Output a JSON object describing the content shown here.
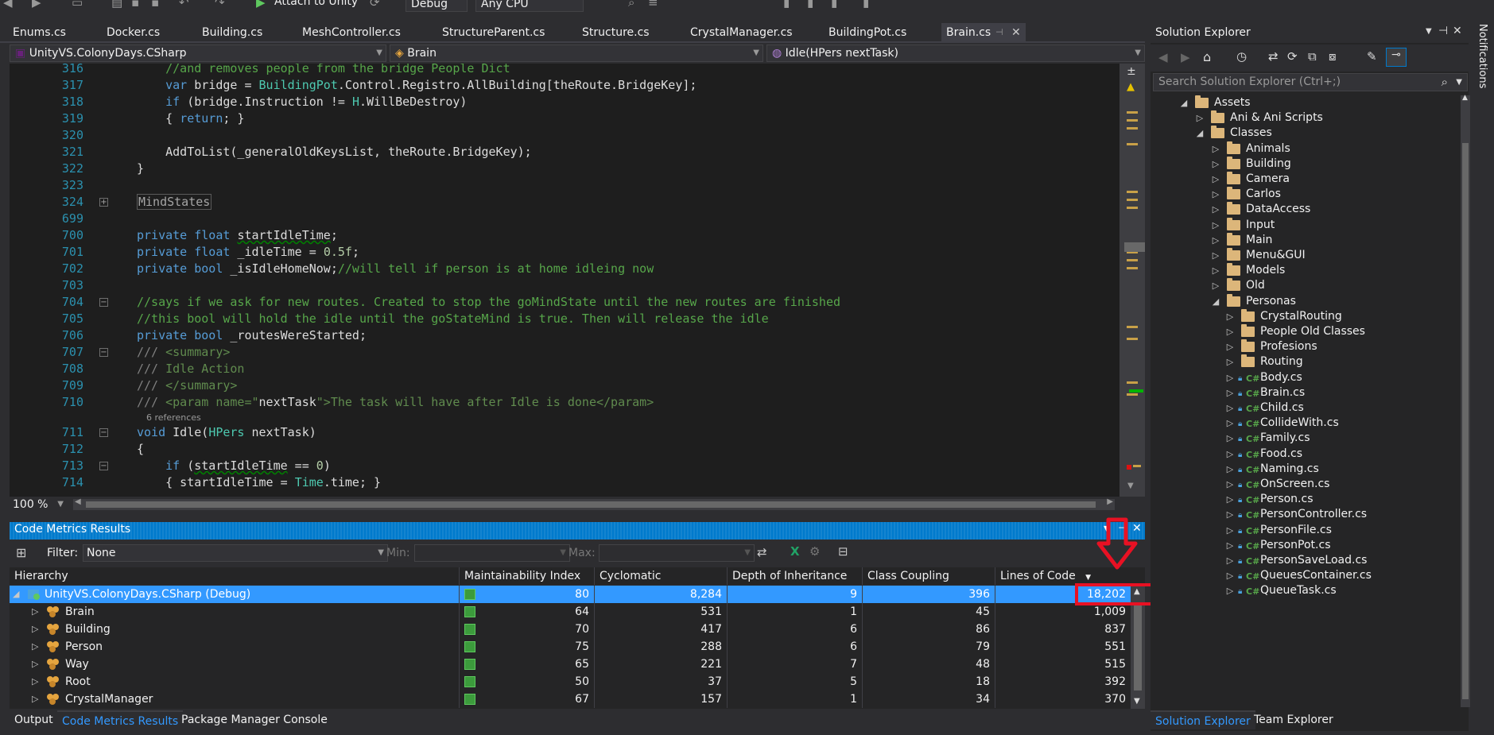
{
  "toolbar": {
    "attach_label": "Attach to Unity",
    "config": "Debug",
    "platform": "Any CPU"
  },
  "doc_tabs": [
    "Enums.cs",
    "Docker.cs",
    "Building.cs",
    "MeshController.cs",
    "StructureParent.cs",
    "Structure.cs",
    "CrystalManager.cs",
    "BuildingPot.cs",
    "Brain.cs"
  ],
  "nav": {
    "project": "UnityVS.ColonyDays.CSharp",
    "class": "Brain",
    "member": "Idle(HPers nextTask)"
  },
  "code": [
    {
      "ln": "316",
      "segs": [
        [
          "cm",
          "    //and removes people from the bridge People Dict"
        ]
      ]
    },
    {
      "ln": "317",
      "segs": [
        [
          "kw",
          "    var"
        ],
        [
          "",
          " bridge = "
        ],
        [
          "ty",
          "BuildingPot"
        ],
        [
          "",
          ".Control.Registro.AllBuilding[theRoute.BridgeKey];"
        ]
      ]
    },
    {
      "ln": "318",
      "segs": [
        [
          "kw",
          "    if"
        ],
        [
          "",
          " (bridge.Instruction != "
        ],
        [
          "ty",
          "H"
        ],
        [
          "",
          ".WillBeDestroy)"
        ]
      ]
    },
    {
      "ln": "319",
      "segs": [
        [
          "",
          "    { "
        ],
        [
          "kw",
          "return"
        ],
        [
          "",
          "; }"
        ]
      ]
    },
    {
      "ln": "320",
      "segs": []
    },
    {
      "ln": "321",
      "segs": [
        [
          "",
          "    AddToList(_generalOldKeysList, theRoute.BridgeKey);"
        ]
      ]
    },
    {
      "ln": "322",
      "segs": [
        [
          "",
          "}"
        ]
      ]
    },
    {
      "ln": "323",
      "segs": []
    },
    {
      "ln": "324",
      "segs": [
        [
          "collapsed",
          "MindStates"
        ]
      ],
      "fold": "+"
    },
    {
      "ln": "699",
      "segs": []
    },
    {
      "ln": "700",
      "segs": [
        [
          "kw",
          "private float"
        ],
        [
          "",
          " "
        ],
        [
          "squig",
          "startIdleTime"
        ],
        [
          "",
          ";"
        ]
      ]
    },
    {
      "ln": "701",
      "segs": [
        [
          "kw",
          "private float"
        ],
        [
          "",
          " _idleTime = "
        ],
        [
          "num",
          "0.5f"
        ],
        [
          "",
          ";"
        ]
      ]
    },
    {
      "ln": "702",
      "segs": [
        [
          "kw",
          "private bool"
        ],
        [
          "",
          " _isIdleHomeNow;"
        ],
        [
          "cm",
          "//will tell if person is at home idleing now"
        ]
      ]
    },
    {
      "ln": "703",
      "segs": []
    },
    {
      "ln": "704",
      "segs": [
        [
          "cm",
          "//says if we ask for new routes. Created to stop the goMindState until the new routes are finished"
        ]
      ],
      "fold": "-"
    },
    {
      "ln": "705",
      "segs": [
        [
          "cm",
          "//this bool will hold the idle until the goStateMind is true. Then will release the idle"
        ]
      ]
    },
    {
      "ln": "706",
      "segs": [
        [
          "kw",
          "private bool"
        ],
        [
          "",
          " _routesWereStarted;"
        ]
      ]
    },
    {
      "ln": "707",
      "segs": [
        [
          "gray",
          "/// "
        ],
        [
          "xml",
          "<summary>"
        ]
      ],
      "fold": "-"
    },
    {
      "ln": "708",
      "segs": [
        [
          "gray",
          "/// "
        ],
        [
          "xml",
          "Idle Action"
        ]
      ]
    },
    {
      "ln": "709",
      "segs": [
        [
          "gray",
          "/// "
        ],
        [
          "xml",
          "</summary>"
        ]
      ]
    },
    {
      "ln": "710",
      "segs": [
        [
          "gray",
          "/// "
        ],
        [
          "xml",
          "<param name=\""
        ],
        [
          "",
          "nextTask"
        ],
        [
          "xml",
          "\">The task will have after Idle is done</param>"
        ]
      ]
    },
    {
      "ln": "711",
      "segs": [
        [
          "kw",
          "void"
        ],
        [
          "",
          " Idle("
        ],
        [
          "ty",
          "HPers"
        ],
        [
          "",
          " nextTask)"
        ]
      ],
      "fold": "-",
      "refs": "6 references"
    },
    {
      "ln": "712",
      "segs": [
        [
          "",
          "{"
        ]
      ]
    },
    {
      "ln": "713",
      "segs": [
        [
          "kw",
          "    if"
        ],
        [
          "",
          " ("
        ],
        [
          "squig",
          "startIdleTime"
        ],
        [
          "",
          " == "
        ],
        [
          "num",
          "0"
        ],
        [
          "",
          ")"
        ]
      ],
      "fold": "-"
    },
    {
      "ln": "714",
      "segs": [
        [
          "",
          "    { startIdleTime = "
        ],
        [
          "ty",
          "Time"
        ],
        [
          "",
          ".time; }"
        ]
      ]
    }
  ],
  "editor": {
    "zoom": "100 %"
  },
  "code_metrics": {
    "title": "Code Metrics Results",
    "filter_label": "Filter:",
    "filter_value": "None",
    "min_label": "Min:",
    "max_label": "Max:",
    "columns": [
      "Hierarchy",
      "Maintainability Index",
      "Cyclomatic Complexity",
      "Depth of Inheritance",
      "Class Coupling",
      "Lines of Code"
    ],
    "rows": [
      {
        "name": "UnityVS.ColonyDays.CSharp (Debug)",
        "mi": "80",
        "cc": "8,284",
        "di": "9",
        "coup": "396",
        "loc": "18,202",
        "root": true
      },
      {
        "name": "Brain",
        "mi": "64",
        "cc": "531",
        "di": "1",
        "coup": "45",
        "loc": "1,009"
      },
      {
        "name": "Building",
        "mi": "70",
        "cc": "417",
        "di": "6",
        "coup": "86",
        "loc": "837"
      },
      {
        "name": "Person",
        "mi": "75",
        "cc": "288",
        "di": "6",
        "coup": "79",
        "loc": "551"
      },
      {
        "name": "Way",
        "mi": "65",
        "cc": "221",
        "di": "7",
        "coup": "48",
        "loc": "515"
      },
      {
        "name": "Root",
        "mi": "50",
        "cc": "37",
        "di": "5",
        "coup": "18",
        "loc": "392"
      },
      {
        "name": "CrystalManager",
        "mi": "67",
        "cc": "157",
        "di": "1",
        "coup": "34",
        "loc": "370"
      }
    ]
  },
  "bottom_tabs": [
    "Output",
    "Code Metrics Results",
    "Package Manager Console"
  ],
  "solution_explorer": {
    "title": "Solution Explorer",
    "search_placeholder": "Search Solution Explorer (Ctrl+;)",
    "tree": [
      {
        "label": "Assets",
        "depth": 0,
        "kind": "folder",
        "open": true
      },
      {
        "label": "Ani & Ani Scripts",
        "depth": 1,
        "kind": "folder"
      },
      {
        "label": "Classes",
        "depth": 1,
        "kind": "folder",
        "open": true
      },
      {
        "label": "Animals",
        "depth": 2,
        "kind": "folder"
      },
      {
        "label": "Building",
        "depth": 2,
        "kind": "folder"
      },
      {
        "label": "Camera",
        "depth": 2,
        "kind": "folder"
      },
      {
        "label": "Carlos",
        "depth": 2,
        "kind": "folder"
      },
      {
        "label": "DataAccess",
        "depth": 2,
        "kind": "folder"
      },
      {
        "label": "Input",
        "depth": 2,
        "kind": "folder"
      },
      {
        "label": "Main",
        "depth": 2,
        "kind": "folder"
      },
      {
        "label": "Menu&GUI",
        "depth": 2,
        "kind": "folder"
      },
      {
        "label": "Models",
        "depth": 2,
        "kind": "folder"
      },
      {
        "label": "Old",
        "depth": 2,
        "kind": "folder"
      },
      {
        "label": "Personas",
        "depth": 2,
        "kind": "folder",
        "open": true
      },
      {
        "label": "CrystalRouting",
        "depth": 3,
        "kind": "folder"
      },
      {
        "label": "People Old Classes",
        "depth": 3,
        "kind": "folder"
      },
      {
        "label": "Profesions",
        "depth": 3,
        "kind": "folder"
      },
      {
        "label": "Routing",
        "depth": 3,
        "kind": "folder"
      },
      {
        "label": "Body.cs",
        "depth": 3,
        "kind": "cs"
      },
      {
        "label": "Brain.cs",
        "depth": 3,
        "kind": "cs"
      },
      {
        "label": "Child.cs",
        "depth": 3,
        "kind": "cs"
      },
      {
        "label": "CollideWith.cs",
        "depth": 3,
        "kind": "cs"
      },
      {
        "label": "Family.cs",
        "depth": 3,
        "kind": "cs"
      },
      {
        "label": "Food.cs",
        "depth": 3,
        "kind": "cs"
      },
      {
        "label": "Naming.cs",
        "depth": 3,
        "kind": "cs"
      },
      {
        "label": "OnScreen.cs",
        "depth": 3,
        "kind": "cs"
      },
      {
        "label": "Person.cs",
        "depth": 3,
        "kind": "cs"
      },
      {
        "label": "PersonController.cs",
        "depth": 3,
        "kind": "cs"
      },
      {
        "label": "PersonFile.cs",
        "depth": 3,
        "kind": "cs"
      },
      {
        "label": "PersonPot.cs",
        "depth": 3,
        "kind": "cs"
      },
      {
        "label": "PersonSaveLoad.cs",
        "depth": 3,
        "kind": "cs"
      },
      {
        "label": "QueuesContainer.cs",
        "depth": 3,
        "kind": "cs"
      },
      {
        "label": "QueueTask.cs",
        "depth": 3,
        "kind": "cs"
      }
    ],
    "tabs": [
      "Solution Explorer",
      "Team Explorer"
    ]
  },
  "notifications_label": "Notifications",
  "colors": {
    "accent": "#007acc",
    "selection": "#3399ff",
    "highlight": "#e81123"
  }
}
